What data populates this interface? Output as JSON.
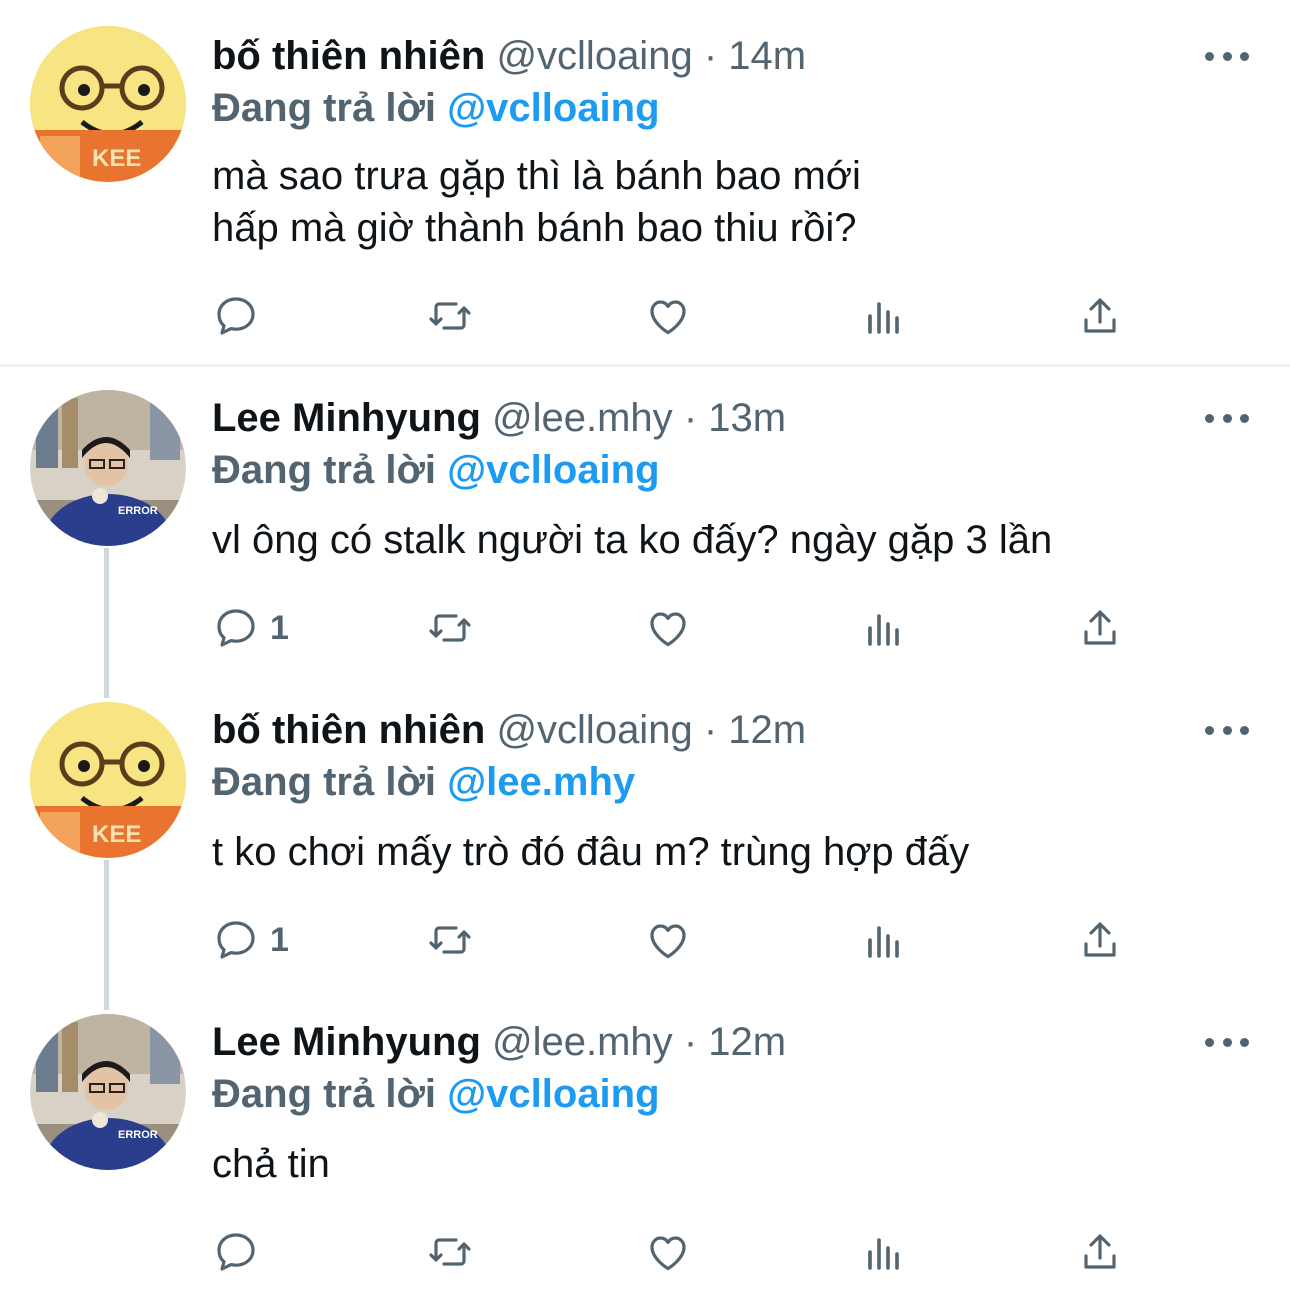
{
  "colors": {
    "text": "#0f1419",
    "secondary": "#536471",
    "link": "#1d9bf0",
    "divider": "#eff3f4",
    "thread": "#cfd9de"
  },
  "tweets": [
    {
      "name": "bố thiên nhiên",
      "handle": "@vclloaing",
      "separator": "·",
      "time": "14m",
      "reply_prefix": "Đang trả lời",
      "reply_to": "@vclloaing",
      "text": "mà sao trưa gặp thì là bánh bao mới\nhấp mà giờ thành bánh bao thiu rồi?",
      "reply_count": "",
      "avatar": "yellow-glasses-plush"
    },
    {
      "name": "Lee Minhyung",
      "handle": "@lee.mhy",
      "separator": "·",
      "time": "13m",
      "reply_prefix": "Đang trả lời",
      "reply_to": "@vclloaing",
      "text": "vl ông có stalk người ta ko đấy? ngày gặp 3 lần",
      "reply_count": "1",
      "avatar": "person-photo"
    },
    {
      "name": "bố thiên nhiên",
      "handle": "@vclloaing",
      "separator": "·",
      "time": "12m",
      "reply_prefix": "Đang trả lời",
      "reply_to": "@lee.mhy",
      "text": "t ko chơi mấy trò đó đâu m? trùng hợp đấy",
      "reply_count": "1",
      "avatar": "yellow-glasses-plush"
    },
    {
      "name": "Lee Minhyung",
      "handle": "@lee.mhy",
      "separator": "·",
      "time": "12m",
      "reply_prefix": "Đang trả lời",
      "reply_to": "@vclloaing",
      "text": "chả tin",
      "reply_count": "",
      "avatar": "person-photo"
    }
  ]
}
